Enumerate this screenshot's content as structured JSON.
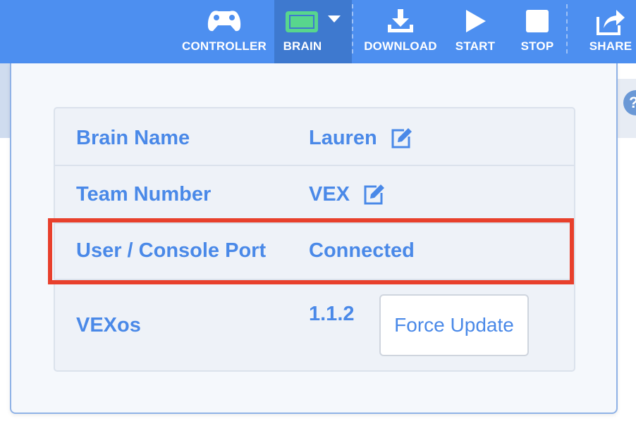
{
  "toolbar": {
    "controller_label": "CONTROLLER",
    "brain_label": "BRAIN",
    "download_label": "DOWNLOAD",
    "start_label": "START",
    "stop_label": "STOP",
    "share_label": "SHARE"
  },
  "help_glyph": "?",
  "brain_info": {
    "rows": [
      {
        "label": "Brain Name",
        "value": "Lauren",
        "editable": true
      },
      {
        "label": "Team Number",
        "value": "VEX",
        "editable": true
      },
      {
        "label": "User / Console Port",
        "value": "Connected",
        "editable": false
      },
      {
        "label": "VEXos",
        "value": "1.1.2",
        "editable": false
      }
    ],
    "force_update_label": "Force Update"
  },
  "colors": {
    "toolbar_bg": "#4d8ff0",
    "brain_tab_bg": "#3e79cf",
    "brain_icon": "#58d68d",
    "text_accent": "#4a89e8",
    "highlight": "#e8402c"
  },
  "icons": {
    "controller": "gamepad-icon",
    "brain": "brain-screen-icon",
    "dropdown": "caret-down-icon",
    "download": "download-icon",
    "start": "play-icon",
    "stop": "stop-icon",
    "share": "share-icon",
    "edit": "edit-icon"
  }
}
